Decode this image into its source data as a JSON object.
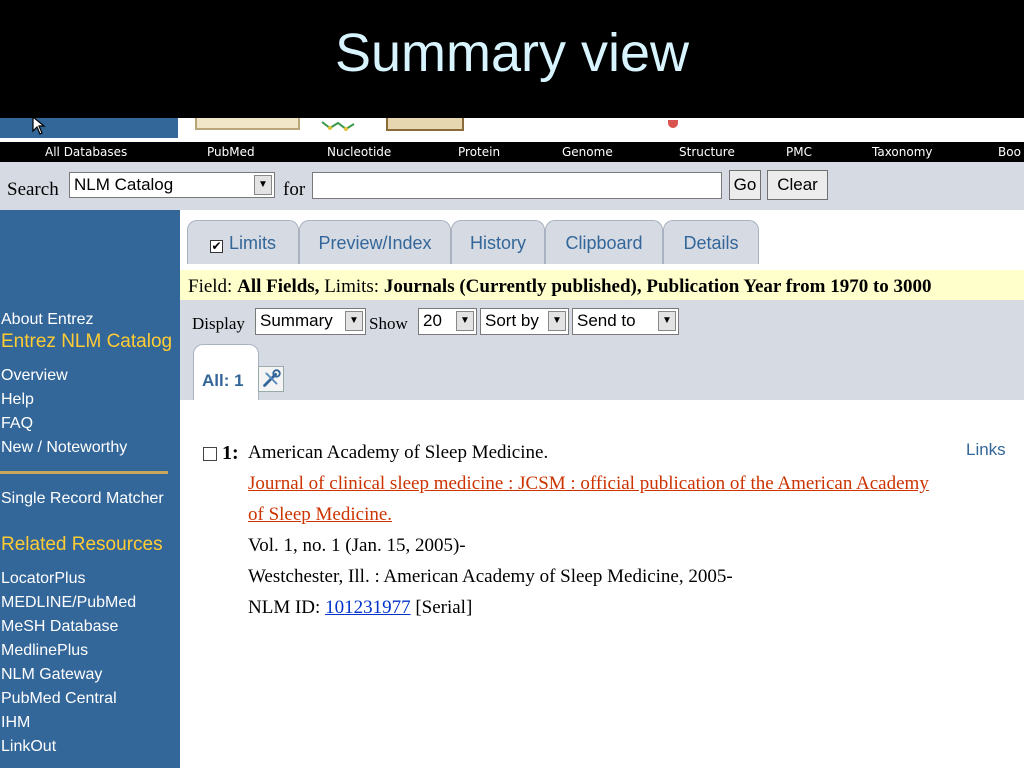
{
  "slide": {
    "title": "Summary view"
  },
  "nav": [
    "All Databases",
    "PubMed",
    "Nucleotide",
    "Protein",
    "Genome",
    "Structure",
    "PMC",
    "Taxonomy",
    "Boo"
  ],
  "search": {
    "label": "Search",
    "database": "NLM Catalog",
    "for_label": "for",
    "query": "",
    "go_label": "Go",
    "clear_label": "Clear"
  },
  "sidebar": {
    "about": "About Entrez",
    "section1_head": "Entrez NLM Catalog",
    "section1_items": [
      "Overview",
      "Help",
      "FAQ",
      "New / Noteworthy"
    ],
    "single_record": "Single Record Matcher",
    "section2_head": "Related Resources",
    "section2_items": [
      "LocatorPlus",
      "MEDLINE/PubMed",
      "MeSH Database",
      "MedlinePlus",
      "NLM Gateway",
      "PubMed Central",
      "IHM",
      "LinkOut"
    ]
  },
  "tabs": {
    "limits": "Limits",
    "preview": "Preview/Index",
    "history": "History",
    "clipboard": "Clipboard",
    "details": "Details",
    "limits_check": "✔"
  },
  "field": {
    "field_label": "Field:",
    "field_value": "All Fields,",
    "limits_label": "Limits:",
    "limits_value": "Journals (Currently published), Publication Year from 1970 to 3000"
  },
  "display": {
    "display_label": "Display",
    "display_value": "Summary",
    "show_label": "Show",
    "show_value": "20",
    "sort_value": "Sort by",
    "send_value": "Send to",
    "all_label": "All: 1"
  },
  "result": {
    "number": "1:",
    "links_label": "Links",
    "author": "American Academy of Sleep Medicine.",
    "title_line1": "Journal of clinical sleep medicine : JCSM : official publication of the American Academy",
    "title_line2": "of Sleep Medicine.",
    "volume": "Vol. 1, no. 1 (Jan. 15, 2005)-",
    "publisher": "Westchester, Ill. : American Academy of Sleep Medicine, 2005-",
    "nlm_id_label": "NLM ID:",
    "nlm_id": "101231977",
    "type": "[Serial]"
  },
  "colors": {
    "sidebar_bg": "#336699",
    "sidebar_head": "#ffcc33",
    "title_link": "#cc3300",
    "id_link": "#0033cc",
    "slide_title": "#d8f4ff"
  }
}
